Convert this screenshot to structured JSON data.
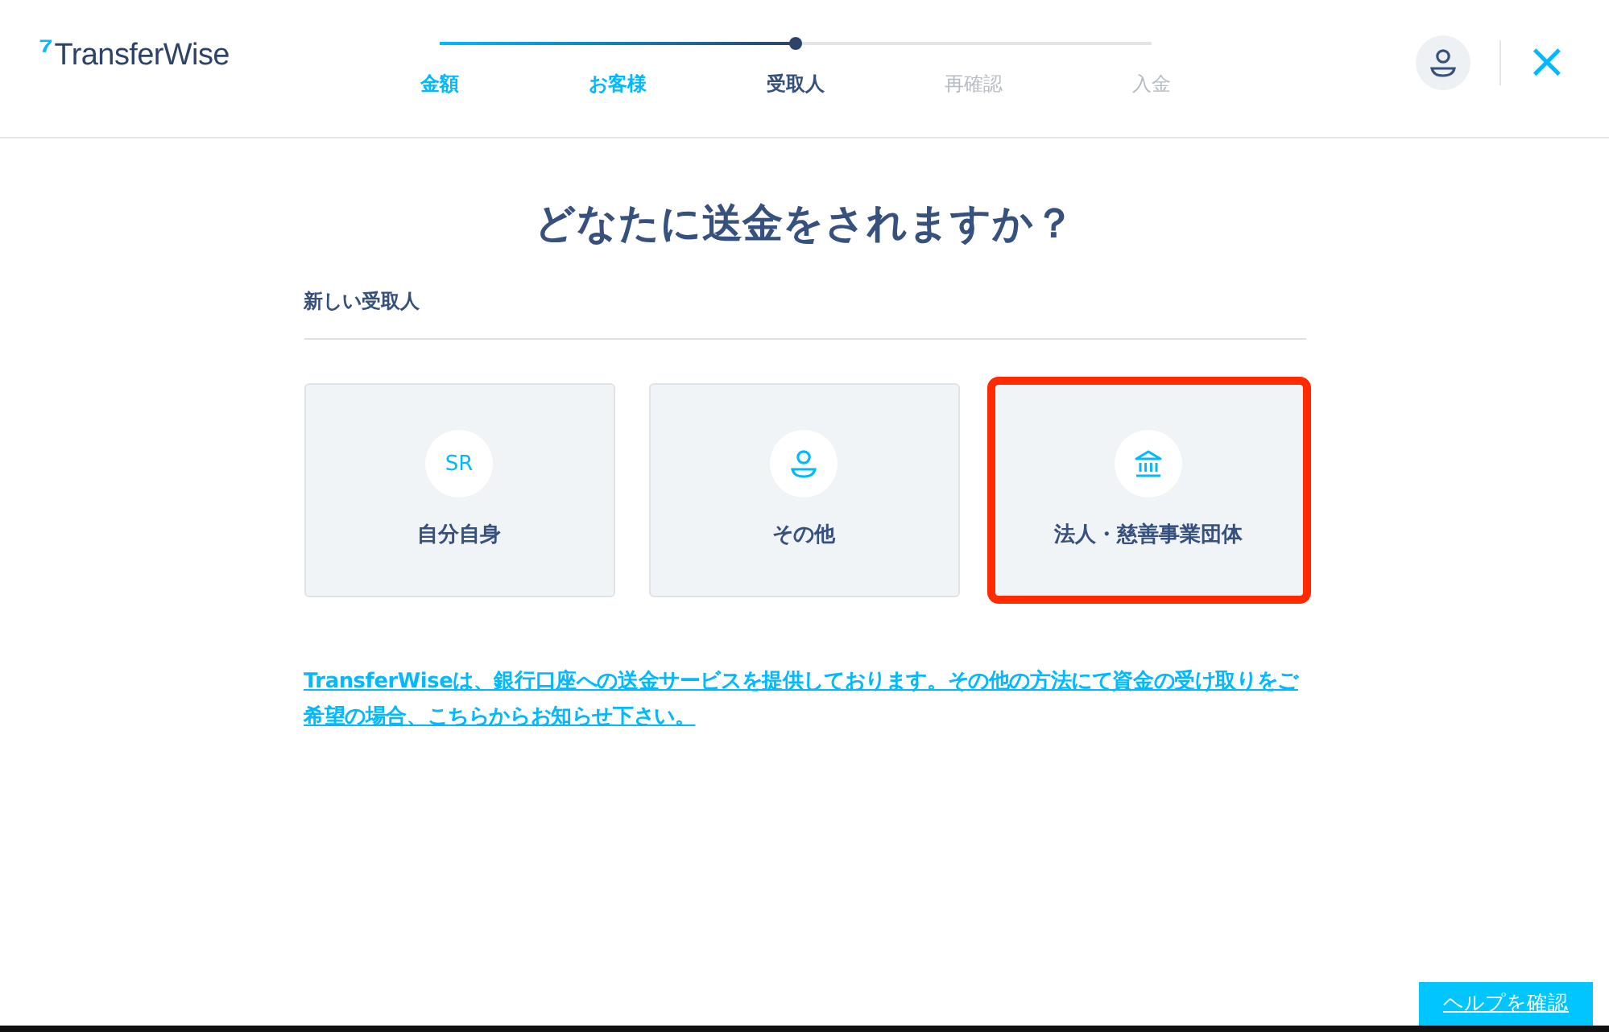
{
  "logo": {
    "mark": "⁷",
    "text": "TransferWise"
  },
  "progress": {
    "level": 0.5,
    "steps": [
      {
        "label": "金額",
        "completed": true,
        "selected": false
      },
      {
        "label": "お客様",
        "completed": true,
        "selected": false
      },
      {
        "label": "受取人",
        "completed": false,
        "selected": true
      },
      {
        "label": "再確認",
        "completed": false,
        "selected": false
      },
      {
        "label": "入金",
        "completed": false,
        "selected": false
      }
    ]
  },
  "close": "×",
  "title": "どなたに送金をされますか？",
  "section": "新しい受取人",
  "options": [
    {
      "kind": "initials",
      "initials": "SR",
      "label": "自分自身",
      "highlighted": false
    },
    {
      "kind": "person",
      "label": "その他",
      "highlighted": false
    },
    {
      "kind": "bank",
      "label": "法人・慈善事業団体",
      "highlighted": true
    }
  ],
  "notice_link": "TransferWiseは、銀行口座への送金サービスを提供しております。その他の方法にて資金の受け取りをご希望の場合、こちらからお知らせ下さい。",
  "help_button": "ヘルプを確認"
}
